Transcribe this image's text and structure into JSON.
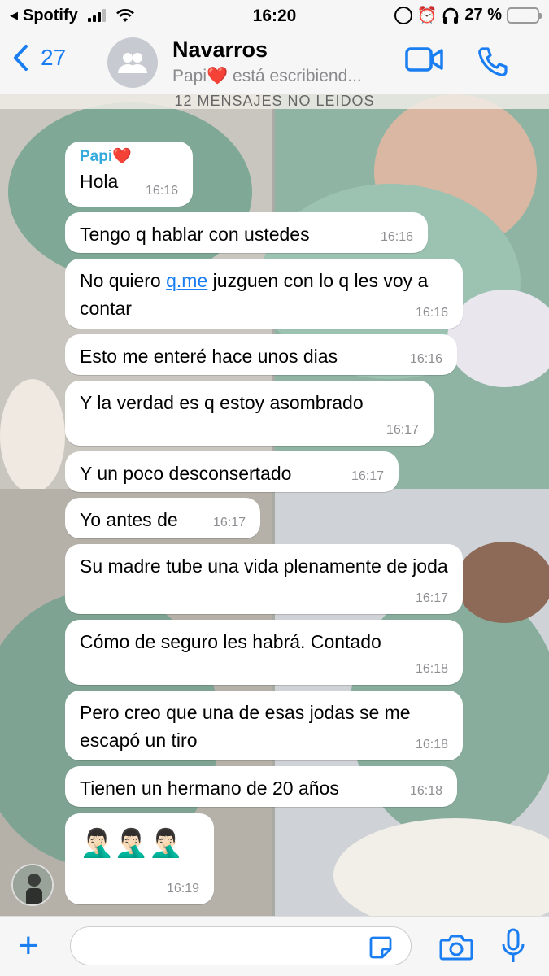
{
  "status_bar": {
    "back_app": "Spotify",
    "time": "16:20",
    "battery": "27 %",
    "battery_level": 0.27
  },
  "header": {
    "back_count": "27",
    "title": "Navarros",
    "subtitle": "Papi❤️ está escribiend..."
  },
  "unread_banner": "12 MENSAJES NO LEIDOS",
  "messages": [
    {
      "sender": "Papi❤️",
      "text": "Hola",
      "time": "16:16"
    },
    {
      "text": "Tengo q hablar con ustedes",
      "time": "16:16"
    },
    {
      "text_before": "No quiero ",
      "link": "q.me",
      "text_after": " juzguen con lo q les voy a contar",
      "time": "16:16"
    },
    {
      "text": "Esto me enteré hace unos dias",
      "time": "16:16"
    },
    {
      "text": "Y la verdad es q estoy asombrado",
      "time": "16:17"
    },
    {
      "text": "Y un poco desconsertado",
      "time": "16:17"
    },
    {
      "text": "Yo antes de",
      "time": "16:17"
    },
    {
      "text": "Su madre tube una vida plenamente de joda",
      "time": "16:17"
    },
    {
      "text": "Cómo de seguro les habrá. Contado",
      "time": "16:18"
    },
    {
      "text": "Pero creo que una de esas jodas se me escapó un tiro",
      "time": "16:18"
    },
    {
      "text": "Tienen un hermano de 20 años",
      "time": "16:18"
    },
    {
      "text": "🤦🏻‍♂️🤦🏻‍♂️🤦🏻‍♂️",
      "time": "16:19"
    }
  ],
  "input": {
    "placeholder": ""
  },
  "icons": {
    "back": "chevron-left-icon",
    "video": "video-camera-icon",
    "call": "phone-icon",
    "add": "plus-icon",
    "sticker": "sticker-icon",
    "camera": "camera-icon",
    "mic": "microphone-icon"
  },
  "colors": {
    "accent": "#1a7ef2",
    "sender_name": "#34aadc",
    "battery_fill": "#f5c400"
  }
}
